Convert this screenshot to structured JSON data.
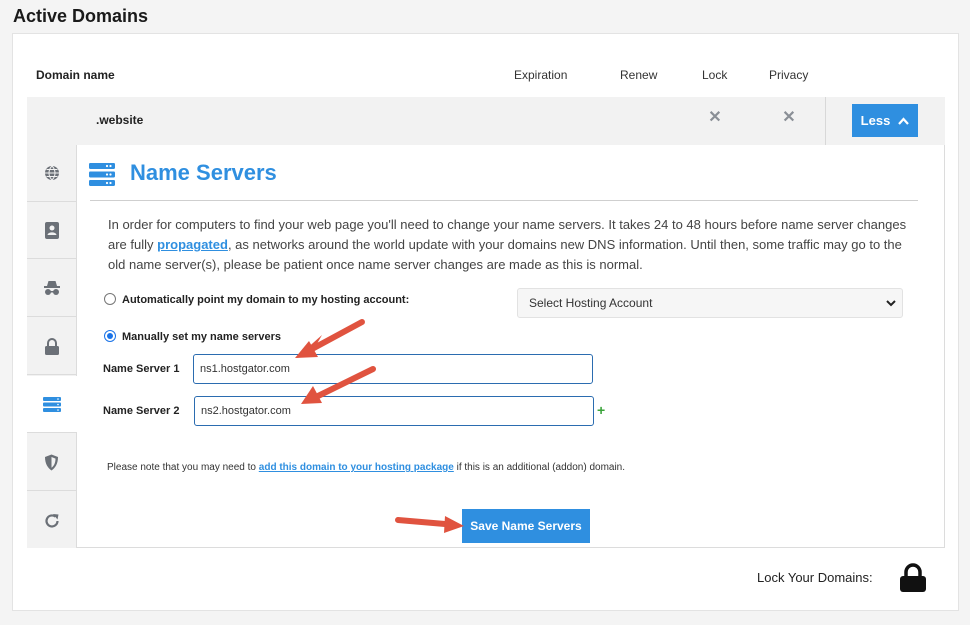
{
  "page": {
    "title": "Active Domains"
  },
  "table": {
    "headers": {
      "domain": "Domain name",
      "expiration": "Expiration",
      "renew": "Renew",
      "lock": "Lock",
      "privacy": "Privacy"
    },
    "row": {
      "domain": ".website",
      "lock_icon": "x-icon",
      "privacy_icon": "x-icon",
      "toggle_label": "Less"
    }
  },
  "side_tabs": [
    "globe-icon",
    "contact-card-icon",
    "incognito-icon",
    "lock-icon",
    "server-icon",
    "shield-icon",
    "refresh-icon"
  ],
  "name_servers": {
    "title": "Name Servers",
    "intro_before": "In order for computers to find your web page you'll need to change your name servers. It takes 24 to 48 hours before name server changes are fully ",
    "intro_link": "propagated",
    "intro_after": ", as networks around the world update with your domains new DNS information. Until then, some traffic may go to the old name server(s), please be patient once name server changes are made as this is normal.",
    "auto_option": "Automatically point my domain to my hosting account:",
    "hosting_select": "Select Hosting Account",
    "manual_option": "Manually set my name servers",
    "ns1_label": "Name Server 1",
    "ns1_value": "ns1.hostgator.com",
    "ns2_label": "Name Server 2",
    "ns2_value": "ns2.hostgator.com",
    "add_symbol": "+",
    "note_before": "Please note that you may need to ",
    "note_link": "add this domain to your hosting package",
    "note_after": " if this is an additional (addon) domain.",
    "save_label": "Save Name Servers"
  },
  "footer": {
    "lock_label": "Lock Your Domains:"
  },
  "colors": {
    "accent": "#2f8fe0",
    "arrow": "#e0533f",
    "add": "#3aa33a"
  }
}
